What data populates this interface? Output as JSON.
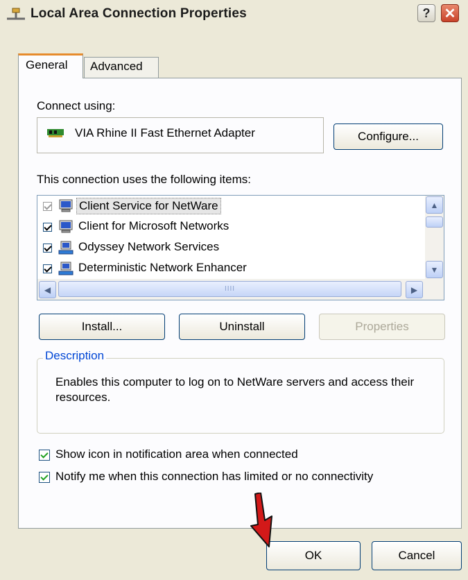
{
  "window": {
    "title": "Local Area Connection Properties"
  },
  "titlebar": {
    "help_label": "?",
    "close_label": "✕"
  },
  "tabs": [
    {
      "label": "General"
    },
    {
      "label": "Advanced"
    }
  ],
  "general": {
    "connect_using_label": "Connect using:",
    "adapter_name": "VIA Rhine II Fast Ethernet Adapter",
    "configure_label": "Configure...",
    "items_label": "This connection uses the following items:",
    "items": [
      {
        "label": "Client Service for NetWare",
        "checked": true,
        "selected": true
      },
      {
        "label": "Client for Microsoft Networks",
        "checked": true,
        "selected": false
      },
      {
        "label": "Odyssey Network Services",
        "checked": true,
        "selected": false
      },
      {
        "label": "Deterministic Network Enhancer",
        "checked": true,
        "selected": false
      }
    ],
    "scroll_grip": "IIII",
    "install_label": "Install...",
    "uninstall_label": "Uninstall",
    "properties_label": "Properties",
    "description_legend": "Description",
    "description_text": "Enables this computer to log on to NetWare servers and access their resources.",
    "show_icon_label": "Show icon in notification area when connected",
    "show_icon_checked": true,
    "notify_label": "Notify me when this connection has limited or no connectivity",
    "notify_checked": true
  },
  "footer": {
    "ok_label": "OK",
    "cancel_label": "Cancel"
  },
  "colors": {
    "accent_tab": "#e68b2c",
    "close_button": "#c9432a",
    "group_legend": "#0046d5",
    "pointer": "#d31919"
  }
}
